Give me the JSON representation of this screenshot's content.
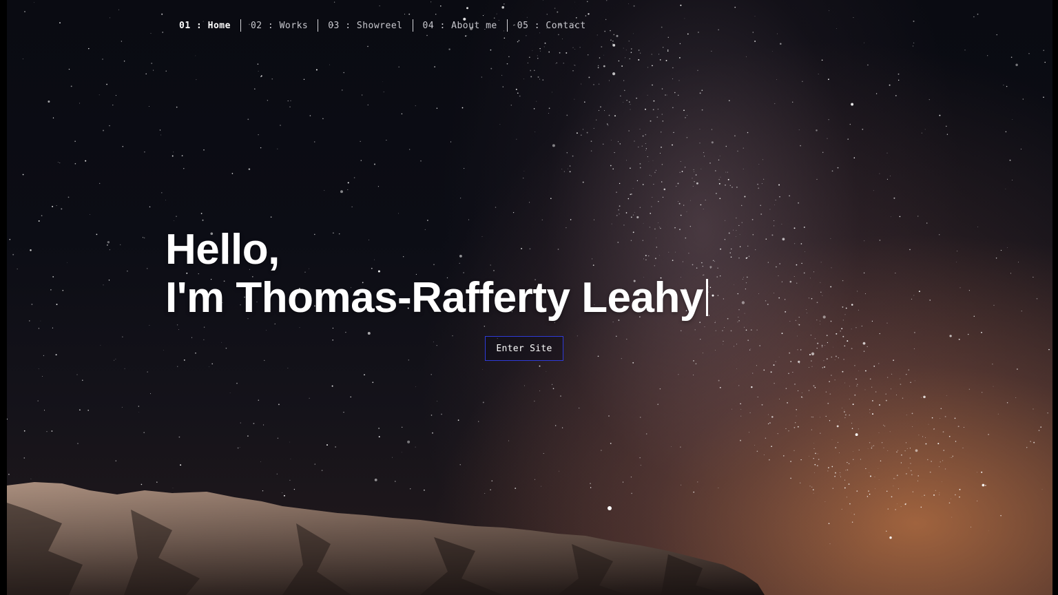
{
  "nav": {
    "items": [
      {
        "number": "01",
        "separator": " : ",
        "label": "Home",
        "active": true
      },
      {
        "number": "02",
        "separator": " : ",
        "label": "Works",
        "active": false
      },
      {
        "number": "03",
        "separator": " : ",
        "label": "Showreel",
        "active": false
      },
      {
        "number": "04",
        "separator": " : ",
        "label": "About me",
        "active": false
      },
      {
        "number": "05",
        "separator": " : ",
        "label": "Contact",
        "active": false
      }
    ]
  },
  "hero": {
    "greeting": "Hello,",
    "intro": "I'm Thomas-Rafferty Leahy"
  },
  "cta": {
    "label": "Enter Site"
  },
  "colors": {
    "text": "#ffffff",
    "nav_text": "#c9c9cf",
    "button_border": "#2f3bd9",
    "sky_dark": "#0a0b12",
    "glow_orange": "#c47846"
  },
  "background": {
    "scene": "starry-night-sky-milky-way-mountain"
  }
}
